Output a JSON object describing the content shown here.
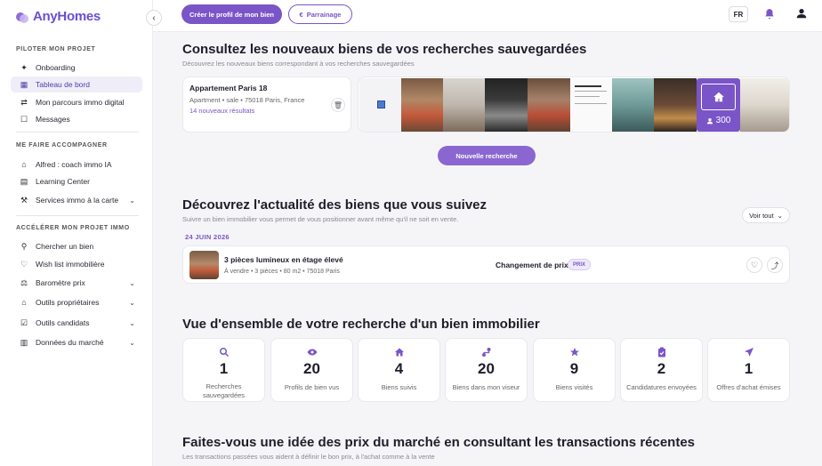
{
  "app": {
    "name": "AnyHomes"
  },
  "sidebar": {
    "section1": "PILOTER MON PROJET",
    "section2": "ME FAIRE ACCOMPAGNER",
    "section3": "ACCÉLÉRER MON PROJET IMMO",
    "items": [
      {
        "label": "Onboarding",
        "icon": "sparkle-icon"
      },
      {
        "label": "Tableau de bord",
        "icon": "dashboard-icon",
        "active": true
      },
      {
        "label": "Mon parcours immo digital",
        "icon": "route-icon"
      },
      {
        "label": "Messages",
        "icon": "chat-icon"
      },
      {
        "label": "Alfred : coach immo IA",
        "icon": "home-icon"
      },
      {
        "label": "Learning Center",
        "icon": "book-icon"
      },
      {
        "label": "Services immo à la carte",
        "icon": "service-icon"
      },
      {
        "label": "Chercher un bien",
        "icon": "search-icon"
      },
      {
        "label": "Wish list immobilière",
        "icon": "heart-icon"
      },
      {
        "label": "Baromètre prix",
        "icon": "scale-icon"
      },
      {
        "label": "Outils propriétaires",
        "icon": "home-outline-icon"
      },
      {
        "label": "Outils candidats",
        "icon": "candidate-icon"
      },
      {
        "label": "Données du marché",
        "icon": "map-icon"
      }
    ]
  },
  "topbar": {
    "create_label": "Créer le profil de mon bien",
    "referral_label": "Parrainage",
    "referral_icon": "€",
    "lang": "FR"
  },
  "saved": {
    "title": "Consultez les nouveaux biens de vos recherches sauvegardées",
    "subtitle": "Découvrez les nouveaux biens correspondant à vos recherches sauvegardées",
    "card_title": "Appartement Paris 18",
    "card_meta": "Apartment • sale • 75018 Paris, France",
    "card_link": "14 nouveaux résultats",
    "more_count": "300",
    "new_search": "Nouvelle recherche"
  },
  "followed": {
    "title": "Découvrez l'actualité des biens que vous suivez",
    "subtitle": "Suivre un bien immobilier vous permet de vous positionner avant même qu'il ne soit en vente.",
    "see_all": "Voir tout",
    "date": "24 JUIN 2026",
    "property_title": "3 pièces lumineux en étage élevé",
    "property_meta": "À vendre • 3 pièces • 80 m2 • 75018 Paris",
    "change": "Changement de prix",
    "badge": "PRIX"
  },
  "overview": {
    "title": "Vue d'ensemble de votre recherche d'un bien immobilier",
    "stats": [
      {
        "value": "1",
        "label": "Recherches sauvegardées",
        "icon": "search-icon"
      },
      {
        "value": "20",
        "label": "Profils de bien vus",
        "icon": "eye-icon"
      },
      {
        "value": "4",
        "label": "Biens suivis",
        "icon": "home-icon"
      },
      {
        "value": "20",
        "label": "Biens dans mon viseur",
        "icon": "target-icon"
      },
      {
        "value": "9",
        "label": "Biens visités",
        "icon": "star-icon"
      },
      {
        "value": "2",
        "label": "Candidatures envoyées",
        "icon": "clipboard-icon"
      },
      {
        "value": "1",
        "label": "Offres d'achat émises",
        "icon": "send-icon"
      }
    ]
  },
  "market": {
    "title": "Faites-vous une idée des prix du marché en consultant les transactions récentes",
    "subtitle": "Les transactions passées vous aident à définir le bon prix, à l'achat comme à la vente"
  },
  "colors": {
    "accent": "#7a55c7",
    "active_bg": "#efedf7"
  }
}
